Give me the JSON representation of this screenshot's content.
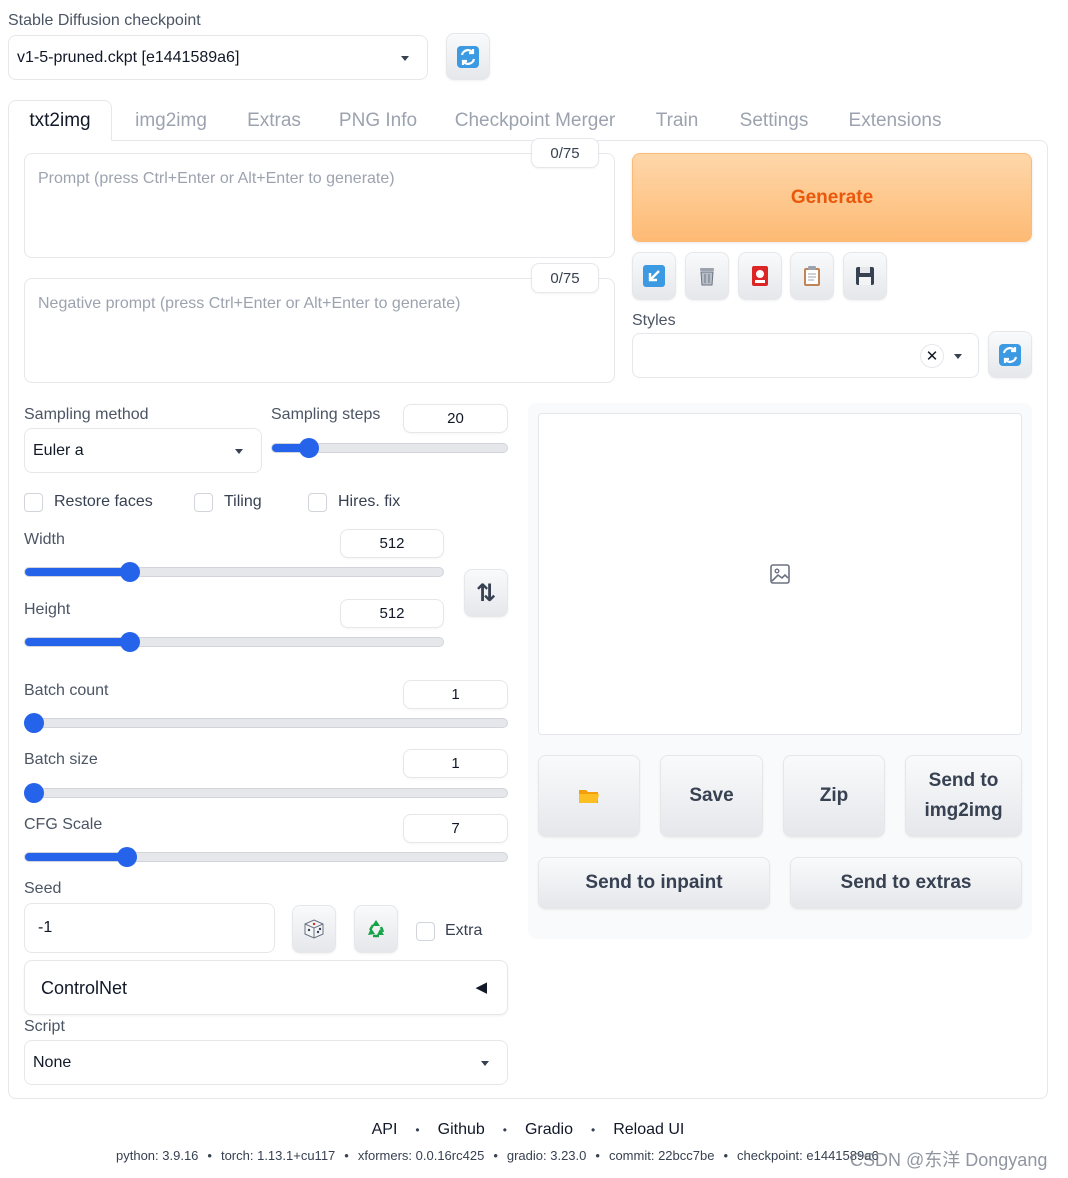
{
  "checkpoint": {
    "label": "Stable Diffusion checkpoint",
    "selected": "v1-5-pruned.ckpt [e1441589a6]",
    "refresh_icon": "refresh-icon"
  },
  "tabs": [
    {
      "label": "txt2img",
      "active": true
    },
    {
      "label": "img2img"
    },
    {
      "label": "Extras"
    },
    {
      "label": "PNG Info"
    },
    {
      "label": "Checkpoint Merger"
    },
    {
      "label": "Train"
    },
    {
      "label": "Settings"
    },
    {
      "label": "Extensions"
    }
  ],
  "prompt": {
    "placeholder": "Prompt (press Ctrl+Enter or Alt+Enter to generate)",
    "counter": "0/75"
  },
  "negative_prompt": {
    "placeholder": "Negative prompt (press Ctrl+Enter or Alt+Enter to generate)",
    "counter": "0/75"
  },
  "generate_label": "Generate",
  "tool_icons": [
    "arrow-down-left-icon",
    "trash-icon",
    "red-card-icon",
    "clipboard-icon",
    "floppy-disk-icon"
  ],
  "styles": {
    "label": "Styles",
    "value": "",
    "clear_glyph": "✕"
  },
  "sampling_method": {
    "label": "Sampling method",
    "value": "Euler a"
  },
  "sampling_steps": {
    "label": "Sampling steps",
    "value": "20",
    "fraction": 0.13
  },
  "options": {
    "restore_faces": "Restore faces",
    "tiling": "Tiling",
    "hires_fix": "Hires. fix"
  },
  "width": {
    "label": "Width",
    "value": "512",
    "fraction": 0.24
  },
  "height": {
    "label": "Height",
    "value": "512",
    "fraction": 0.24
  },
  "swap_glyph": "⇅",
  "batch_count": {
    "label": "Batch count",
    "value": "1",
    "fraction": 0.0
  },
  "batch_size": {
    "label": "Batch size",
    "value": "1",
    "fraction": 0.0
  },
  "cfg_scale": {
    "label": "CFG Scale",
    "value": "7",
    "fraction": 0.2
  },
  "seed": {
    "label": "Seed",
    "value": "-1",
    "extra_label": "Extra"
  },
  "controlnet": {
    "label": "ControlNet",
    "toggle_glyph": "◀"
  },
  "script": {
    "label": "Script",
    "value": "None"
  },
  "output": {
    "save": "Save",
    "zip": "Zip",
    "send_img2img": "Send to img2img",
    "send_inpaint": "Send to inpaint",
    "send_extras": "Send to extras"
  },
  "footer": {
    "links": [
      "API",
      "Github",
      "Gradio",
      "Reload UI"
    ],
    "separator": "•",
    "info": {
      "python": "python: 3.9.16",
      "torch": "torch: 1.13.1+cu117",
      "xformers": "xformers: 0.0.16rc425",
      "gradio": "gradio: 3.23.0",
      "commit": "commit: 22bcc7be",
      "checkpoint": "checkpoint: e1441589a6"
    },
    "watermark": "CSDN @东洋 Dongyang"
  }
}
